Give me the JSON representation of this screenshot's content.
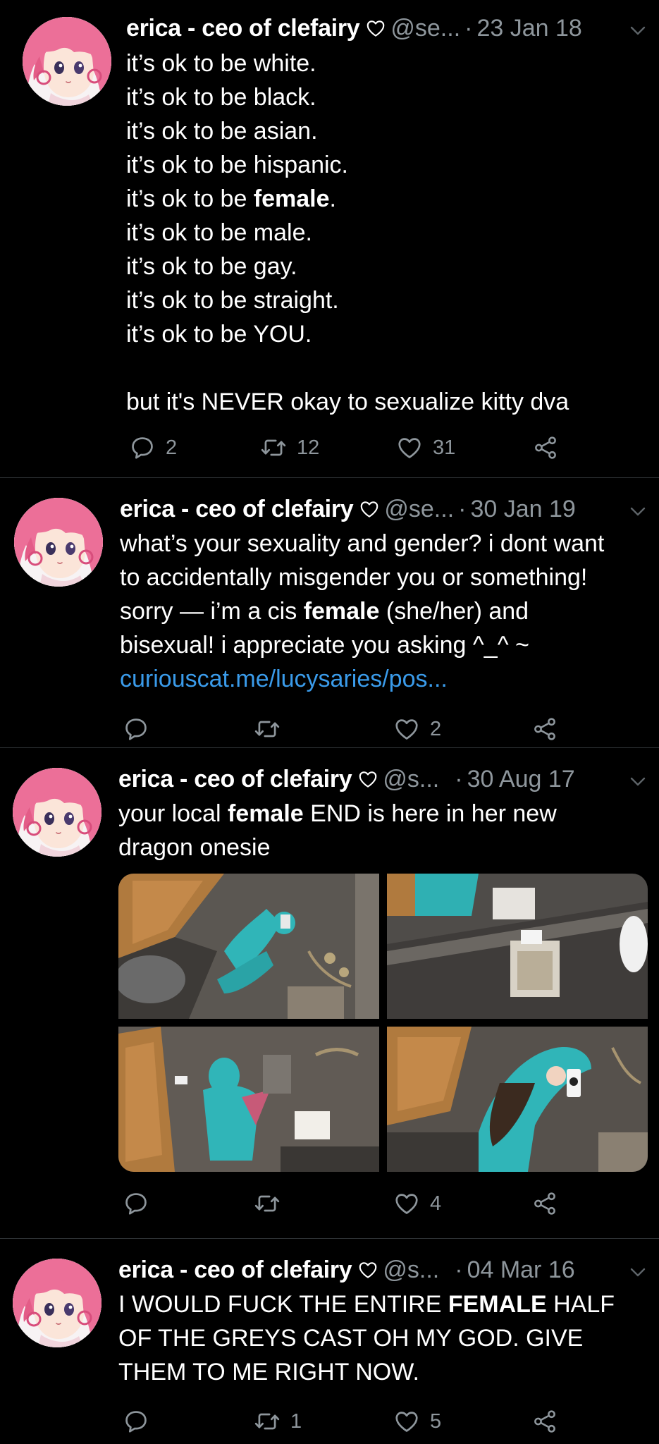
{
  "colors": {
    "background": "#000000",
    "divider": "#2f3336",
    "secondary_text": "#8e969c",
    "link": "#3a9bea",
    "teal_onesie": "#30b5b8",
    "avatar_hair": "#ec6f98"
  },
  "tweets": [
    {
      "author_name": "erica - ceo of clefairy",
      "handle": "@se...",
      "date": "23 Jan 18",
      "lines": [
        {
          "pre": "it’s ok to be white.",
          "bold": "",
          "post": ""
        },
        {
          "pre": "it’s ok to be black.",
          "bold": "",
          "post": ""
        },
        {
          "pre": "it’s ok to be asian.",
          "bold": "",
          "post": ""
        },
        {
          "pre": "it’s ok to be hispanic.",
          "bold": "",
          "post": ""
        },
        {
          "pre": "it’s ok to be ",
          "bold": "female",
          "post": "."
        },
        {
          "pre": "it’s ok to be male.",
          "bold": "",
          "post": ""
        },
        {
          "pre": "it’s ok to be gay.",
          "bold": "",
          "post": ""
        },
        {
          "pre": "it’s ok to be straight.",
          "bold": "",
          "post": ""
        },
        {
          "pre": "it’s ok to be YOU.",
          "bold": "",
          "post": ""
        },
        {
          "pre": "but it's NEVER okay to sexualize kitty dva",
          "bold": "",
          "post": ""
        }
      ],
      "reply_count": "2",
      "retweet_count": "12",
      "like_count": "31"
    },
    {
      "author_name": "erica - ceo of clefairy",
      "handle": "@se...",
      "date": "30 Jan 19",
      "lines": [
        {
          "pre": "what’s your sexuality and gender? i dont want",
          "bold": "",
          "post": ""
        },
        {
          "pre": "to accidentally misgender you or something!",
          "bold": "",
          "post": ""
        },
        {
          "pre": "sorry — i’m a cis ",
          "bold": "female",
          "post": " (she/her) and"
        },
        {
          "pre": "bisexual! i appreciate you asking ^_^ ~",
          "bold": "",
          "post": ""
        }
      ],
      "link": "curiouscat.me/lucysaries/pos...",
      "reply_count": "",
      "retweet_count": "",
      "like_count": "2"
    },
    {
      "author_name": "erica - ceo of clefairy",
      "handle": "@s...",
      "date": "30 Aug 17",
      "lines": [
        {
          "pre": "your local ",
          "bold": "female",
          "post": " END is here in her new"
        },
        {
          "pre": "dragon onesie",
          "bold": "",
          "post": ""
        }
      ],
      "media": [
        {
          "subject": "bathroom mirror selfie in teal dragon onesie"
        },
        {
          "subject": "bathroom counter with tissue box"
        },
        {
          "subject": "back view of teal dragon onesie with pink wings"
        },
        {
          "subject": "mirror selfie holding phone in dragon hood"
        }
      ],
      "reply_count": "",
      "retweet_count": "",
      "like_count": "4"
    },
    {
      "author_name": "erica - ceo of clefairy",
      "handle": "@s...",
      "date": "04 Mar 16",
      "lines": [
        {
          "pre": "I WOULD FUCK THE ENTIRE ",
          "bold": "FEMALE",
          "post": " HALF"
        },
        {
          "pre": "OF THE GREYS CAST OH MY GOD. GIVE",
          "bold": "",
          "post": ""
        },
        {
          "pre": "THEM TO ME RIGHT NOW.",
          "bold": "",
          "post": ""
        }
      ],
      "reply_count": "",
      "retweet_count": "1",
      "like_count": "5"
    }
  ]
}
